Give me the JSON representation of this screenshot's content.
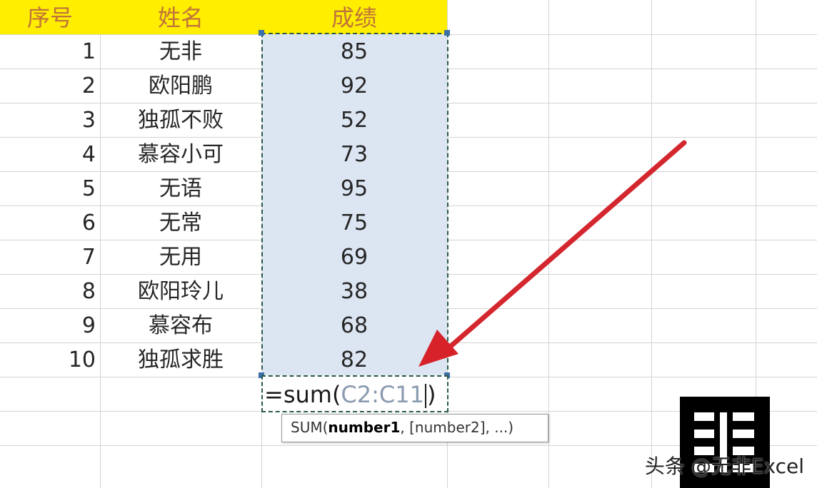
{
  "headers": {
    "seq": "序号",
    "name": "姓名",
    "score": "成绩"
  },
  "rows": [
    {
      "seq": "1",
      "name": "无非",
      "score": "85"
    },
    {
      "seq": "2",
      "name": "欧阳鹏",
      "score": "92"
    },
    {
      "seq": "3",
      "name": "独孤不败",
      "score": "52"
    },
    {
      "seq": "4",
      "name": "慕容小可",
      "score": "73"
    },
    {
      "seq": "5",
      "name": "无语",
      "score": "95"
    },
    {
      "seq": "6",
      "name": "无常",
      "score": "75"
    },
    {
      "seq": "7",
      "name": "无用",
      "score": "69"
    },
    {
      "seq": "8",
      "name": "欧阳玲儿",
      "score": "38"
    },
    {
      "seq": "9",
      "name": "慕容布",
      "score": "68"
    },
    {
      "seq": "10",
      "name": "独孤求胜",
      "score": "82"
    }
  ],
  "formula": {
    "prefix": "=sum(",
    "ref": "C2:C11",
    "suffix": ")"
  },
  "tooltip": {
    "fn": "SUM(",
    "arg1": "number1",
    "rest": ", [number2], ...)"
  },
  "watermark": "头条 @无非Excel",
  "colors": {
    "header_fill": "#ffee00",
    "header_text": "#c0733a",
    "selection_fill": "#dce5f2",
    "arrow": "#d7222a",
    "ref_text": "#8a9ab0"
  },
  "icons": [
    "arrow-annotation",
    "logo-mark"
  ]
}
